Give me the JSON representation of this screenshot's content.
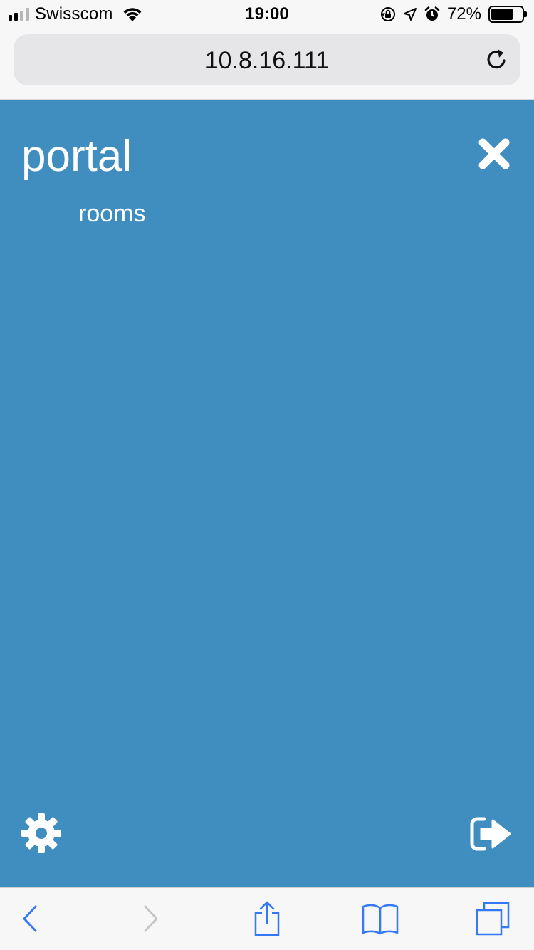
{
  "status_bar": {
    "carrier": "Swisscom",
    "time": "19:00",
    "battery_percent_label": "72%",
    "battery_level": 0.72,
    "signal_bars_filled": 2,
    "signal_bars_total": 4,
    "icons": [
      "signal-icon",
      "wifi-icon",
      "orientation-lock-icon",
      "location-icon",
      "alarm-icon",
      "battery-icon"
    ]
  },
  "address_bar": {
    "url": "10.8.16.111",
    "reload_icon": "reload-icon"
  },
  "panel": {
    "background": "#3f8ebf",
    "title": "portal",
    "close_icon": "close-icon",
    "menu": [
      {
        "label": "rooms"
      }
    ],
    "settings_icon": "gear-icon",
    "logout_icon": "sign-out-icon"
  },
  "toolbar": {
    "accent": "#3478f6",
    "buttons": [
      {
        "name": "back-button",
        "icon": "chevron-left-icon",
        "enabled": true
      },
      {
        "name": "forward-button",
        "icon": "chevron-right-icon",
        "enabled": false
      },
      {
        "name": "share-button",
        "icon": "share-icon",
        "enabled": true
      },
      {
        "name": "bookmarks-button",
        "icon": "book-icon",
        "enabled": true
      },
      {
        "name": "tabs-button",
        "icon": "tabs-icon",
        "enabled": true
      }
    ]
  }
}
